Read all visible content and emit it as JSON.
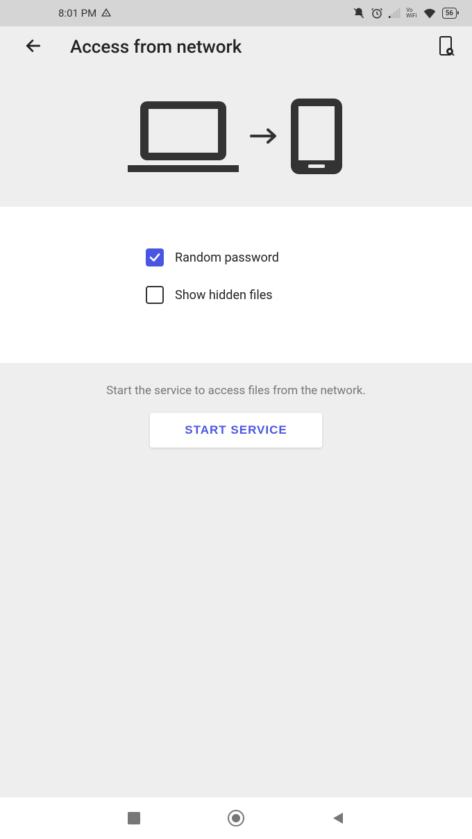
{
  "status_bar": {
    "time": "8:01 PM",
    "battery_level": "56",
    "vowifi_top": "Vo",
    "vowifi_bottom": "WiFi"
  },
  "header": {
    "title": "Access from network"
  },
  "options": {
    "random_password": {
      "label": "Random password",
      "checked": true
    },
    "show_hidden": {
      "label": "Show hidden files",
      "checked": false
    }
  },
  "service": {
    "hint": "Start the service to access files from the network.",
    "button_label": "START SERVICE"
  }
}
